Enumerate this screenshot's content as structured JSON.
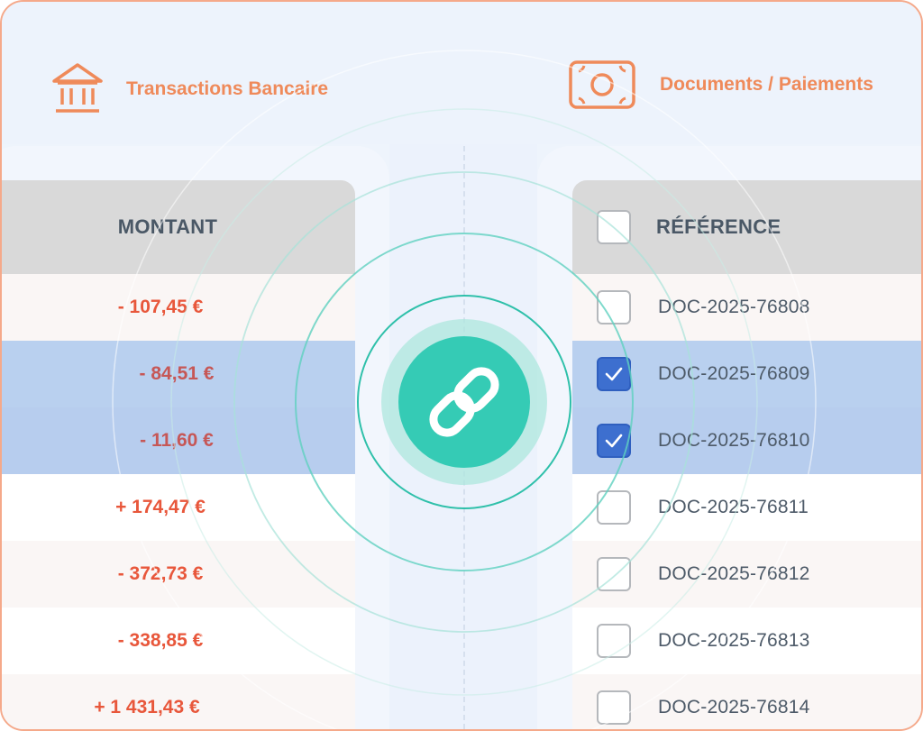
{
  "header": {
    "left_label": "Transactions Bancaire",
    "right_label": "Documents / Paiements",
    "left_icon": "bank-icon",
    "right_icon": "banknote-icon"
  },
  "transactions": {
    "column_header": "MONTANT",
    "rows": [
      {
        "amount": "- 107,45 €",
        "selected": false
      },
      {
        "amount": "- 84,51 €",
        "selected": true
      },
      {
        "amount": "- 11,60 €",
        "selected": true
      },
      {
        "amount": "+ 174,47 €",
        "selected": false
      },
      {
        "amount": "- 372,73 €",
        "selected": false
      },
      {
        "amount": "- 338,85 €",
        "selected": false
      },
      {
        "amount": "+ 1 431,43 €",
        "selected": false
      }
    ]
  },
  "documents": {
    "column_header": "RÉFÉRENCE",
    "select_all_checked": false,
    "rows": [
      {
        "reference": "DOC-2025-76808",
        "checked": false
      },
      {
        "reference": "DOC-2025-76809",
        "checked": true
      },
      {
        "reference": "DOC-2025-76810",
        "checked": true
      },
      {
        "reference": "DOC-2025-76811",
        "checked": false
      },
      {
        "reference": "DOC-2025-76812",
        "checked": false
      },
      {
        "reference": "DOC-2025-76813",
        "checked": false
      },
      {
        "reference": "DOC-2025-76814",
        "checked": false
      }
    ]
  },
  "link_button": {
    "icon": "link-icon"
  },
  "colors": {
    "accent_orange": "#ef8a5a",
    "amount_red": "#e8573b",
    "selected_row": "#b9d0ef",
    "checkbox_checked": "#3d6fcf",
    "link_teal": "#35cbb5"
  }
}
